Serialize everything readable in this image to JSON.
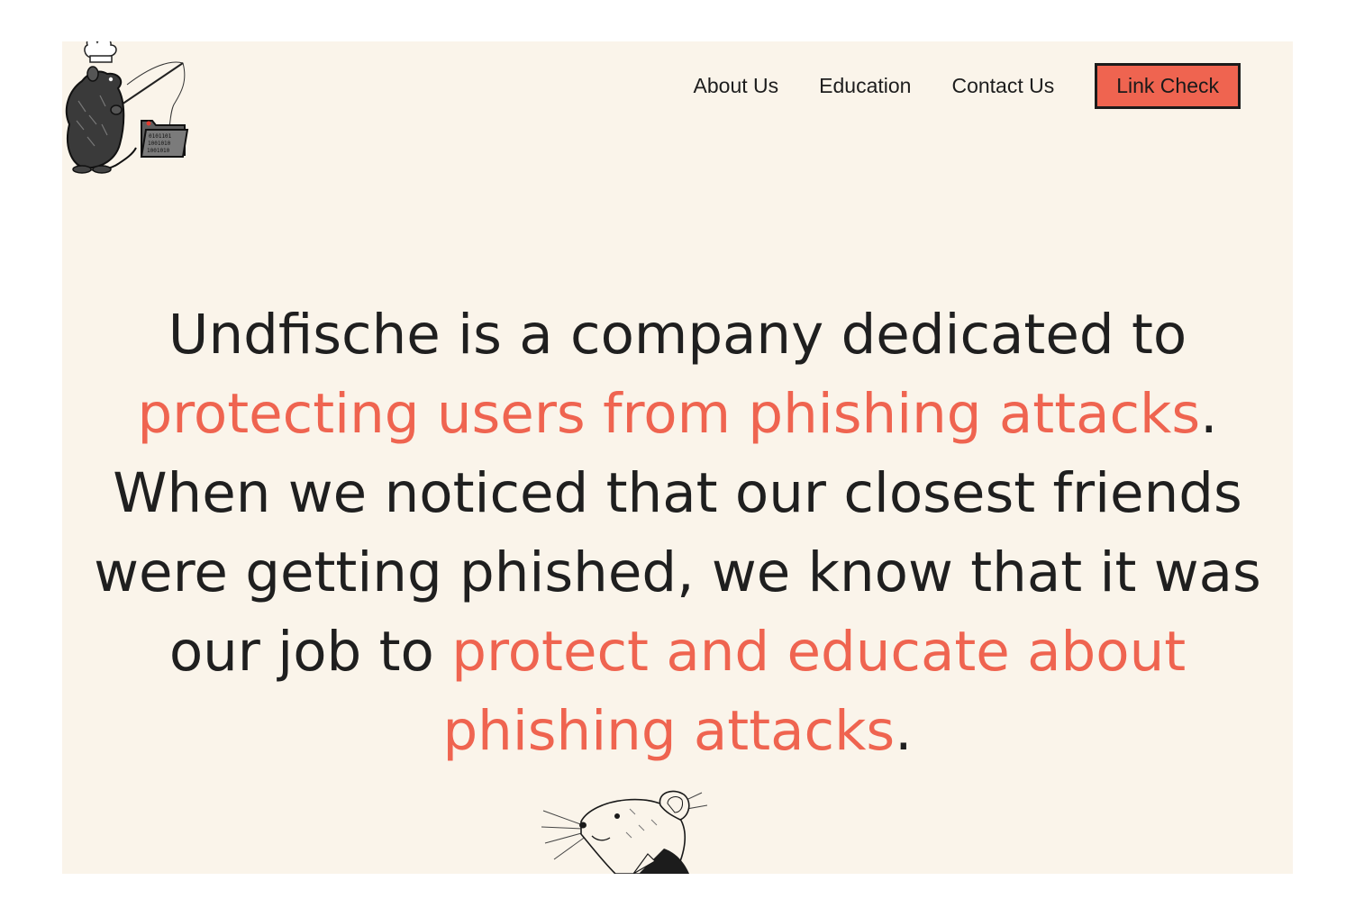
{
  "nav": {
    "items": [
      "About Us",
      "Education",
      "Contact Us"
    ],
    "cta_label": "Link Check"
  },
  "hero": {
    "line1": "Undfische is a company dedicated to",
    "accent1": "protecting users from phishing attacks",
    "period1": ".",
    "line3": "When we noticed that our closest friends",
    "line4": "were getting phished, we know that it was",
    "line5_prefix": "our job to ",
    "accent2_a": "protect and educate about",
    "accent2_b": "phishing attacks",
    "period2": "."
  },
  "logo": {
    "folder_text": [
      "0101101",
      "1001010",
      "1001010"
    ]
  },
  "colors": {
    "background": "#faf4ea",
    "accent": "#ef6450",
    "text": "#1f1f1f"
  }
}
